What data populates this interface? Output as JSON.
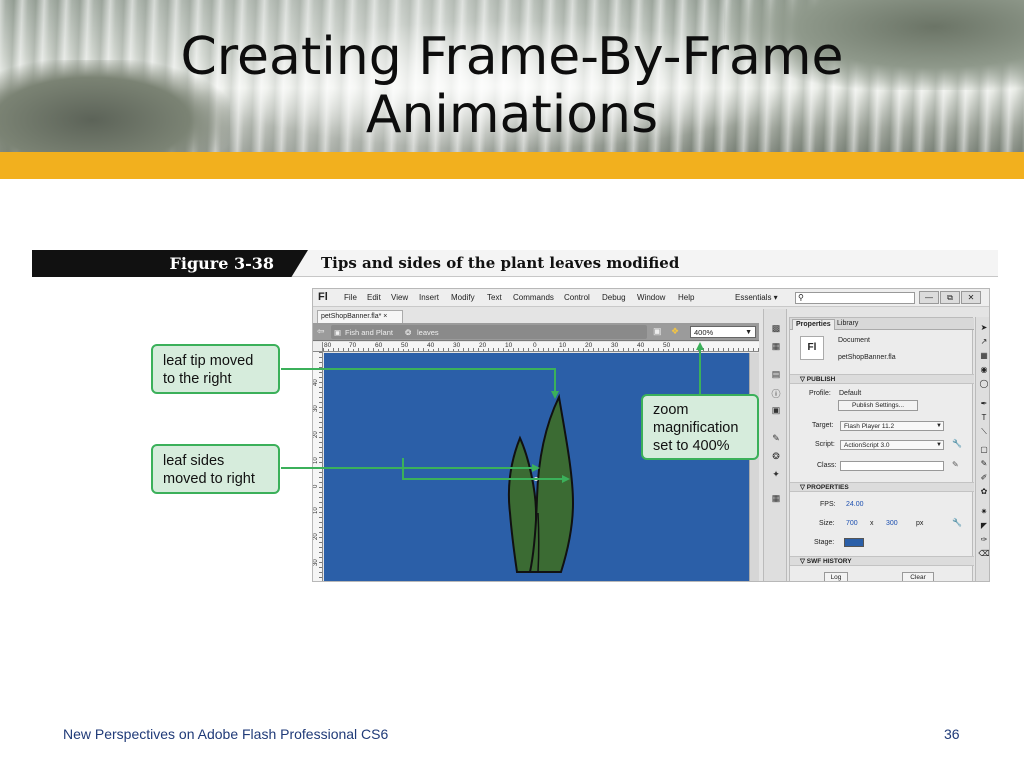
{
  "slide": {
    "title_line1": "Creating Frame-By-Frame",
    "title_line2": "Animations",
    "footer_left": "New Perspectives on Adobe Flash Professional CS6",
    "page_number": "36",
    "accent_color": "#f2b01e",
    "footer_color": "#1f3a78"
  },
  "figure": {
    "label": "Figure 3-38",
    "caption": "Tips and sides of the plant leaves modified"
  },
  "callouts": {
    "leaf_tip": {
      "line1": "leaf tip moved",
      "line2": "to the right"
    },
    "leaf_sides": {
      "line1": "leaf sides",
      "line2": "moved to right"
    },
    "zoom": {
      "line1": "zoom",
      "line2": "magnification",
      "line3": "set to 400%"
    },
    "color": "#3bb05a"
  },
  "app": {
    "logo": "Fl",
    "menu": [
      "File",
      "Edit",
      "View",
      "Insert",
      "Modify",
      "Text",
      "Commands",
      "Control",
      "Debug",
      "Window",
      "Help"
    ],
    "workspace": "Essentials ▾",
    "search_icon": "search-icon",
    "window_buttons": [
      "—",
      "⧉",
      "✕"
    ],
    "doc_tab": "petShopBanner.fla* ×",
    "breadcrumb_scene": "Fish and Plant",
    "breadcrumb_symbol": "leaves",
    "zoom_value": "400%",
    "ruler_h": [
      "80",
      "70",
      "60",
      "50",
      "40",
      "30",
      "20",
      "10",
      "0",
      "10",
      "20",
      "30",
      "40",
      "50"
    ],
    "ruler_v": [
      "40",
      "30",
      "20",
      "10",
      "0",
      "10",
      "20",
      "30"
    ],
    "stage_color": "#2b5fa8",
    "leaf_fill": "#3b6b33"
  },
  "properties": {
    "tab_properties": "Properties",
    "tab_library": "Library",
    "doc_icon": "Fl",
    "doc_type": "Document",
    "doc_name": "petShopBanner.fla",
    "section_publish": "▽ PUBLISH",
    "profile_label": "Profile:",
    "profile_value": "Default",
    "publish_settings": "Publish Settings...",
    "target_label": "Target:",
    "target_value": "Flash Player 11.2",
    "script_label": "Script:",
    "script_value": "ActionScript 3.0",
    "class_label": "Class:",
    "section_properties": "▽ PROPERTIES",
    "fps_label": "FPS:",
    "fps_value": "24.00",
    "size_label": "Size:",
    "width_value": "700",
    "size_x": "x",
    "height_value": "300",
    "size_unit": "px",
    "stage_label": "Stage:",
    "section_swf": "▽ SWF HISTORY",
    "log_button": "Log",
    "clear_button": "Clear"
  }
}
